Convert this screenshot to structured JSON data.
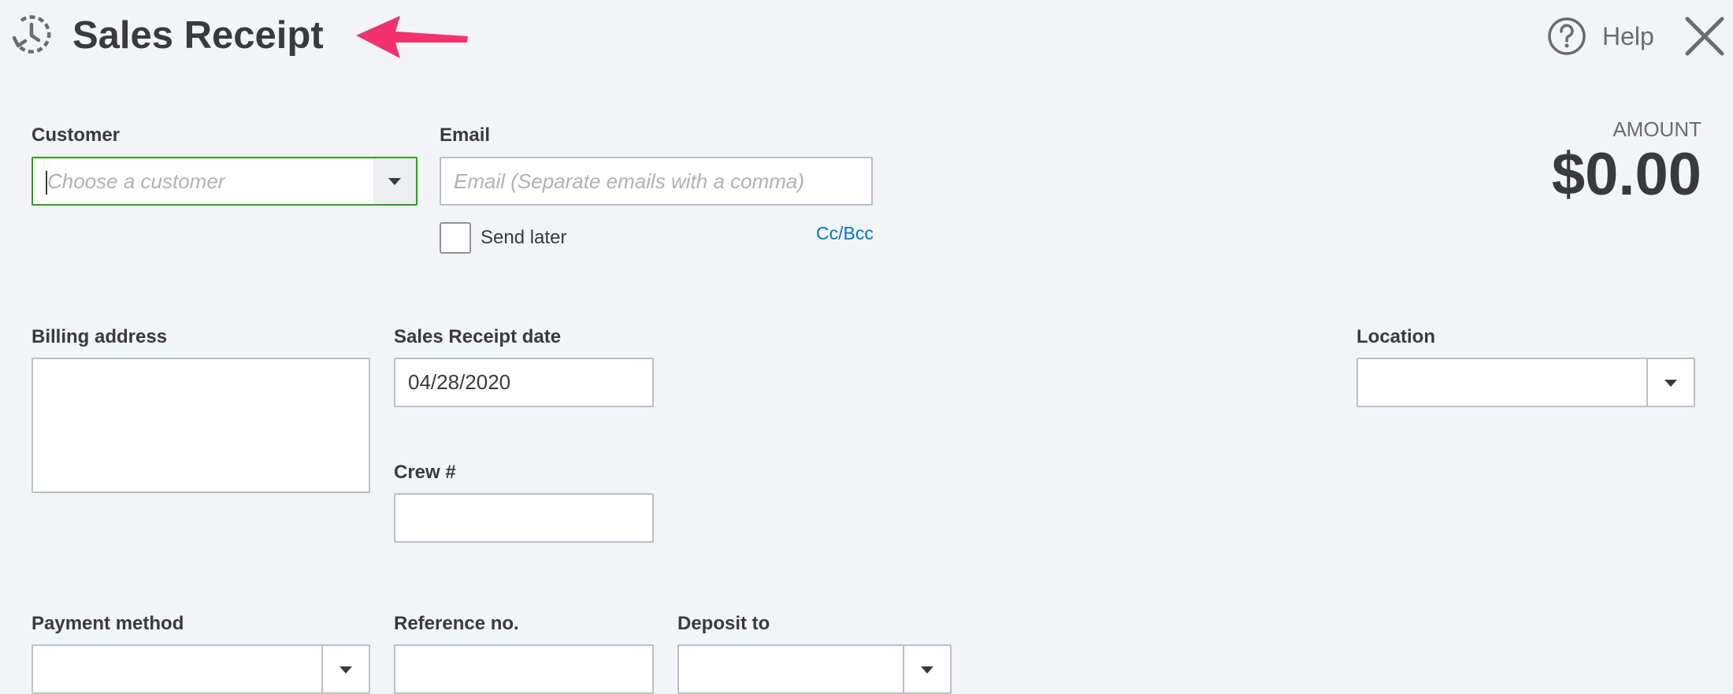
{
  "header": {
    "title": "Sales Receipt",
    "recent_icon": "recent-transactions-icon",
    "help_label": "Help",
    "help_icon": "help-circle-icon",
    "close_icon": "close-icon",
    "annotation_arrow_color": "#f2326e"
  },
  "customer": {
    "label": "Customer",
    "placeholder": "Choose a customer",
    "border_color": "#2ca01c"
  },
  "email": {
    "label": "Email",
    "placeholder": "Email (Separate emails with a comma)",
    "send_later_label": "Send later",
    "send_later_checked": false,
    "ccbcc_label": "Cc/Bcc"
  },
  "amount": {
    "label": "AMOUNT",
    "value": "$0.00"
  },
  "billing_address": {
    "label": "Billing address",
    "value": ""
  },
  "receipt_date": {
    "label": "Sales Receipt date",
    "value": "04/28/2020"
  },
  "crew": {
    "label": "Crew #",
    "value": ""
  },
  "location": {
    "label": "Location",
    "value": ""
  },
  "payment_method": {
    "label": "Payment method",
    "value": ""
  },
  "reference_no": {
    "label": "Reference no.",
    "value": ""
  },
  "deposit_to": {
    "label": "Deposit to",
    "value": ""
  },
  "colors": {
    "background": "#f3f4f8",
    "link": "#0077c5",
    "text": "#393a3d"
  }
}
